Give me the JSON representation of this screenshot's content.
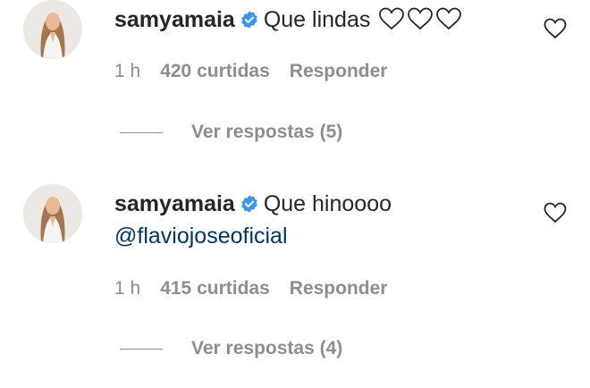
{
  "comments": [
    {
      "username": "samyamaia",
      "text": "Que lindas",
      "inline_hearts": 3,
      "time": "1 h",
      "likes": "420 curtidas",
      "reply_label": "Responder",
      "view_replies": "Ver respostas (5)"
    },
    {
      "username": "samyamaia",
      "text": "Que hinoooo",
      "mention": "@flaviojoseoficial",
      "time": "1 h",
      "likes": "415 curtidas",
      "reply_label": "Responder",
      "view_replies": "Ver respostas (4)"
    }
  ],
  "icons": {
    "verified": "verified-badge-icon",
    "like": "heart-outline-icon",
    "inline": "heart-outline-icon"
  },
  "colors": {
    "verified": "#3897f0",
    "mention": "#00376b",
    "meta": "#8e8e8e",
    "text": "#262626"
  }
}
